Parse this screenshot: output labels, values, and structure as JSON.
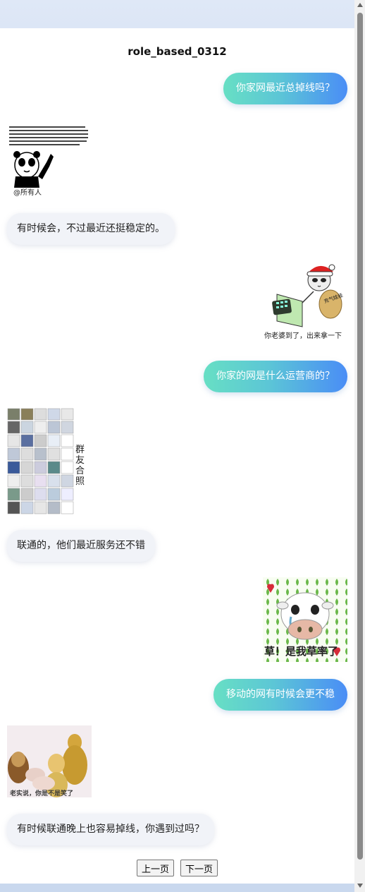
{
  "page_title": "role_based_0312",
  "messages": [
    {
      "side": "right",
      "type": "text",
      "text": "你家网最近总掉线吗？"
    },
    {
      "side": "left",
      "type": "sticker",
      "name": "panda-meme-sticker",
      "caption": "@所有人",
      "small_text": "今天全付定通告单几万，几十万，几百万的都发，我都给记了，且所有什么都选，大家都要确发，多研研一下，以后都不知道你们怎么有钱，有时候那态度不好是我的不对，以后我们重新认识一下！"
    },
    {
      "side": "left",
      "type": "text",
      "text": "有时候会，不过最近还挺稳定的。"
    },
    {
      "side": "right",
      "type": "sticker",
      "name": "santa-panda-sticker",
      "caption": "你老婆到了，出来拿一下",
      "bag_text": "充气娃娃"
    },
    {
      "side": "right",
      "type": "text",
      "text": "你家的网是什么运营商的？"
    },
    {
      "side": "left",
      "type": "sticker",
      "name": "router-collage-sticker",
      "side_text": "群友合照"
    },
    {
      "side": "left",
      "type": "text",
      "text": "联通的，他们最近服务还不错"
    },
    {
      "side": "right",
      "type": "sticker",
      "name": "crying-cow-sticker",
      "caption": "草！是我草率了"
    },
    {
      "side": "right",
      "type": "text",
      "text": "移动的网有时候会更不稳"
    },
    {
      "side": "left",
      "type": "sticker",
      "name": "buddha-statues-sticker",
      "caption": "老实说，你是不是笑了"
    },
    {
      "side": "left",
      "type": "text",
      "text": "有时候联通晚上也容易掉线，你遇到过吗？"
    }
  ],
  "pager": {
    "prev_label": "上一页",
    "next_label": "下一页"
  },
  "colors": {
    "bubble_gradient_start": "#67dfc4",
    "bubble_gradient_end": "#4a8df6",
    "left_bubble_bg": "#f1f3f8"
  }
}
